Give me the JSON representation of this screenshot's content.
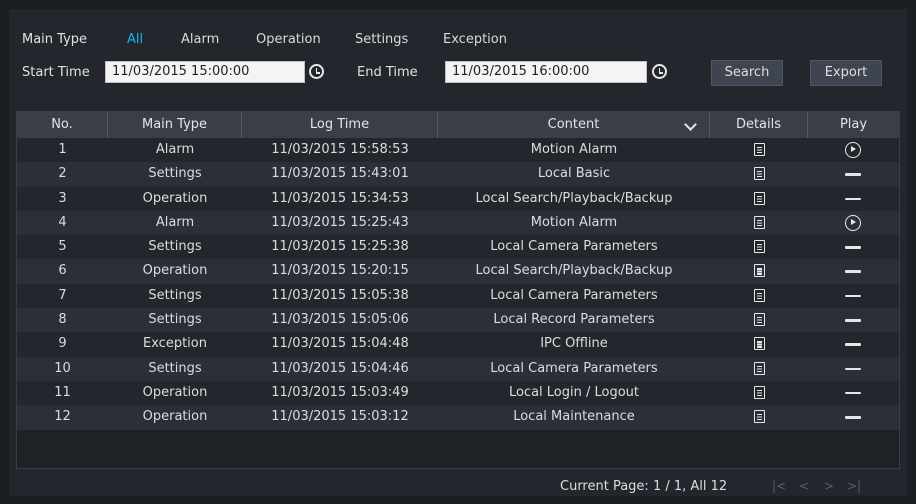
{
  "filters": {
    "main_type_label": "Main Type",
    "types": [
      "All",
      "Alarm",
      "Operation",
      "Settings",
      "Exception"
    ],
    "active_type": "All",
    "start_time_label": "Start Time",
    "start_time_value": "11/03/2015 15:00:00",
    "end_time_label": "End Time",
    "end_time_value": "11/03/2015 16:00:00",
    "search_label": "Search",
    "export_label": "Export"
  },
  "table": {
    "columns": [
      "No.",
      "Main Type",
      "Log Time",
      "Content",
      "Details",
      "Play"
    ],
    "rows": [
      {
        "no": "1",
        "type": "Alarm",
        "time": "11/03/2015 15:58:53",
        "content": "Motion Alarm",
        "play": "play"
      },
      {
        "no": "2",
        "type": "Settings",
        "time": "11/03/2015 15:43:01",
        "content": "Local Basic",
        "play": "none"
      },
      {
        "no": "3",
        "type": "Operation",
        "time": "11/03/2015 15:34:53",
        "content": "Local Search/Playback/Backup",
        "play": "none"
      },
      {
        "no": "4",
        "type": "Alarm",
        "time": "11/03/2015 15:25:43",
        "content": "Motion Alarm",
        "play": "play"
      },
      {
        "no": "5",
        "type": "Settings",
        "time": "11/03/2015 15:25:38",
        "content": "Local Camera Parameters",
        "play": "none"
      },
      {
        "no": "6",
        "type": "Operation",
        "time": "11/03/2015 15:20:15",
        "content": "Local Search/Playback/Backup",
        "play": "none"
      },
      {
        "no": "7",
        "type": "Settings",
        "time": "11/03/2015 15:05:38",
        "content": "Local Camera Parameters",
        "play": "none"
      },
      {
        "no": "8",
        "type": "Settings",
        "time": "11/03/2015 15:05:06",
        "content": "Local Record Parameters",
        "play": "none"
      },
      {
        "no": "9",
        "type": "Exception",
        "time": "11/03/2015 15:04:48",
        "content": "IPC Offline",
        "play": "none"
      },
      {
        "no": "10",
        "type": "Settings",
        "time": "11/03/2015 15:04:46",
        "content": "Local Camera Parameters",
        "play": "none"
      },
      {
        "no": "11",
        "type": "Operation",
        "time": "11/03/2015 15:03:49",
        "content": "Local Login / Logout",
        "play": "none"
      },
      {
        "no": "12",
        "type": "Operation",
        "time": "11/03/2015 15:03:12",
        "content": "Local Maintenance",
        "play": "none"
      }
    ]
  },
  "footer": {
    "page_info": "Current Page: 1 / 1, All 12",
    "first_icon": "first-page-icon",
    "prev_icon": "prev-page-icon",
    "next_icon": "next-page-icon",
    "last_icon": "last-page-icon"
  },
  "colors": {
    "accent": "#17b4e6",
    "background": "#23272d",
    "header": "#3a3f47"
  }
}
